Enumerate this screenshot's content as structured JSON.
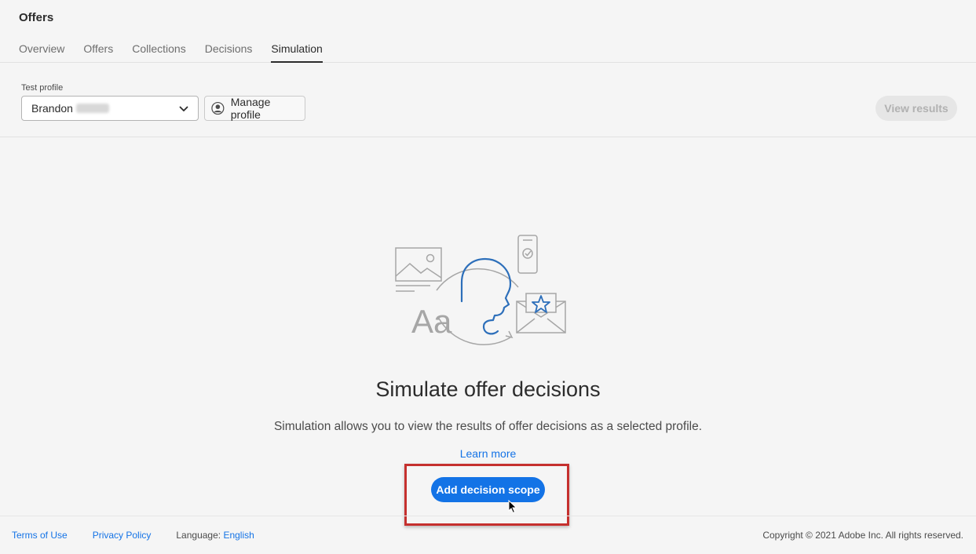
{
  "app": {
    "title": "Offers"
  },
  "tabs": [
    {
      "label": "Overview",
      "active": false
    },
    {
      "label": "Offers",
      "active": false
    },
    {
      "label": "Collections",
      "active": false
    },
    {
      "label": "Decisions",
      "active": false
    },
    {
      "label": "Simulation",
      "active": true
    }
  ],
  "toolbar": {
    "test_profile_label": "Test profile",
    "selected_profile": "Brandon",
    "manage_profile_label": "Manage profile",
    "view_results_label": "View results"
  },
  "empty_state": {
    "title": "Simulate offer decisions",
    "description": "Simulation allows you to view the results of offer decisions as a selected profile.",
    "learn_more": "Learn more",
    "cta_label": "Add decision scope",
    "illustration_text": "Aa"
  },
  "footer": {
    "terms": "Terms of Use",
    "privacy": "Privacy Policy",
    "language_label": "Language:",
    "language_value": "English",
    "copyright": "Copyright  ©  2021 Adobe Inc.  All rights reserved."
  },
  "colors": {
    "accent": "#1373e6",
    "highlight": "#c5302e",
    "background": "#f5f5f5"
  }
}
